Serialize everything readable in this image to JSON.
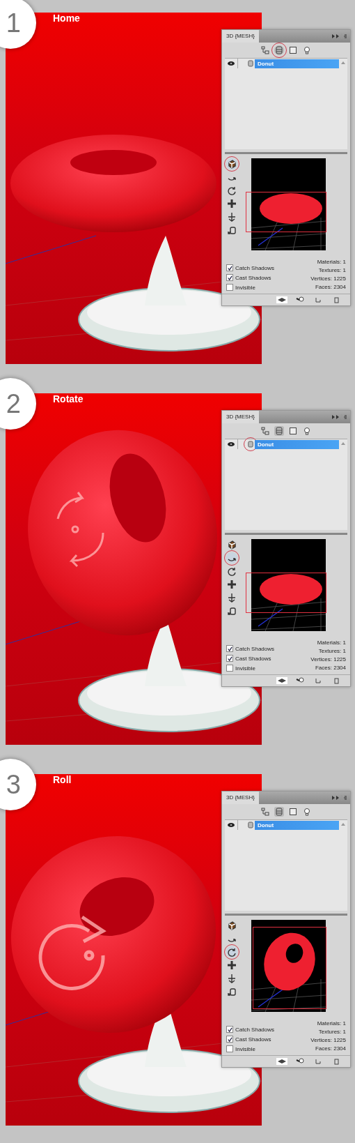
{
  "steps": [
    {
      "number": "1",
      "title": "Home",
      "scene": {
        "kind": "flat"
      },
      "panel": {
        "tab": "3D {MESH}",
        "filters": [
          {
            "kind": "scene",
            "selected": false,
            "circled": false
          },
          {
            "kind": "mesh",
            "selected": true,
            "circled": true
          },
          {
            "kind": "material",
            "selected": false,
            "circled": false
          },
          {
            "kind": "light",
            "selected": false,
            "circled": false
          }
        ],
        "layer": {
          "name": "Donut",
          "selected": true,
          "icon_circled": false
        },
        "tools": [
          {
            "kind": "cube",
            "selected": true
          },
          {
            "kind": "curve",
            "selected": false
          },
          {
            "kind": "rotate",
            "selected": false
          },
          {
            "kind": "pan",
            "selected": false
          },
          {
            "kind": "slide",
            "selected": false
          },
          {
            "kind": "scale",
            "selected": false
          }
        ],
        "preview": {
          "kind": "flat"
        },
        "options": [
          {
            "label": "Catch Shadows",
            "checked": true
          },
          {
            "label": "Cast Shadows",
            "checked": true
          },
          {
            "label": "Invisible",
            "checked": false
          }
        ],
        "stats": [
          "Materials: 1",
          "Textures: 1",
          "Vertices: 1225",
          "Faces: 2304"
        ]
      }
    },
    {
      "number": "2",
      "title": "Rotate",
      "scene": {
        "kind": "upright",
        "overlay": {
          "kind": "rotate"
        }
      },
      "panel": {
        "tab": "3D {MESH}",
        "filters": [
          {
            "kind": "scene",
            "selected": false,
            "circled": false
          },
          {
            "kind": "mesh",
            "selected": true,
            "circled": false
          },
          {
            "kind": "material",
            "selected": false,
            "circled": false
          },
          {
            "kind": "light",
            "selected": false,
            "circled": false
          }
        ],
        "layer": {
          "name": "Donut",
          "selected": true,
          "icon_circled": true
        },
        "tools": [
          {
            "kind": "cube",
            "selected": false
          },
          {
            "kind": "curve",
            "selected": true
          },
          {
            "kind": "rotate",
            "selected": false
          },
          {
            "kind": "pan",
            "selected": false
          },
          {
            "kind": "slide",
            "selected": false
          },
          {
            "kind": "scale",
            "selected": false
          }
        ],
        "preview": {
          "kind": "flat"
        },
        "options": [
          {
            "label": "Catch Shadows",
            "checked": true
          },
          {
            "label": "Cast Shadows",
            "checked": true
          },
          {
            "label": "Invisible",
            "checked": false
          }
        ],
        "stats": [
          "Materials: 1",
          "Textures: 1",
          "Vertices: 1225",
          "Faces: 2304"
        ]
      }
    },
    {
      "number": "3",
      "title": "Roll",
      "scene": {
        "kind": "tilted",
        "overlay": {
          "kind": "roll"
        }
      },
      "panel": {
        "tab": "3D {MESH}",
        "filters": [
          {
            "kind": "scene",
            "selected": false,
            "circled": false
          },
          {
            "kind": "mesh",
            "selected": true,
            "circled": false
          },
          {
            "kind": "material",
            "selected": false,
            "circled": false
          },
          {
            "kind": "light",
            "selected": false,
            "circled": false
          }
        ],
        "layer": {
          "name": "Donut",
          "selected": true,
          "icon_circled": false
        },
        "tools": [
          {
            "kind": "cube",
            "selected": false
          },
          {
            "kind": "curve",
            "selected": false
          },
          {
            "kind": "rotate",
            "selected": true
          },
          {
            "kind": "pan",
            "selected": false
          },
          {
            "kind": "slide",
            "selected": false
          },
          {
            "kind": "scale",
            "selected": false
          }
        ],
        "preview": {
          "kind": "tilted"
        },
        "options": [
          {
            "label": "Catch Shadows",
            "checked": true
          },
          {
            "label": "Cast Shadows",
            "checked": true
          },
          {
            "label": "Invisible",
            "checked": false
          }
        ],
        "stats": [
          "Materials: 1",
          "Textures: 1",
          "Vertices: 1225",
          "Faces: 2304"
        ]
      }
    }
  ]
}
